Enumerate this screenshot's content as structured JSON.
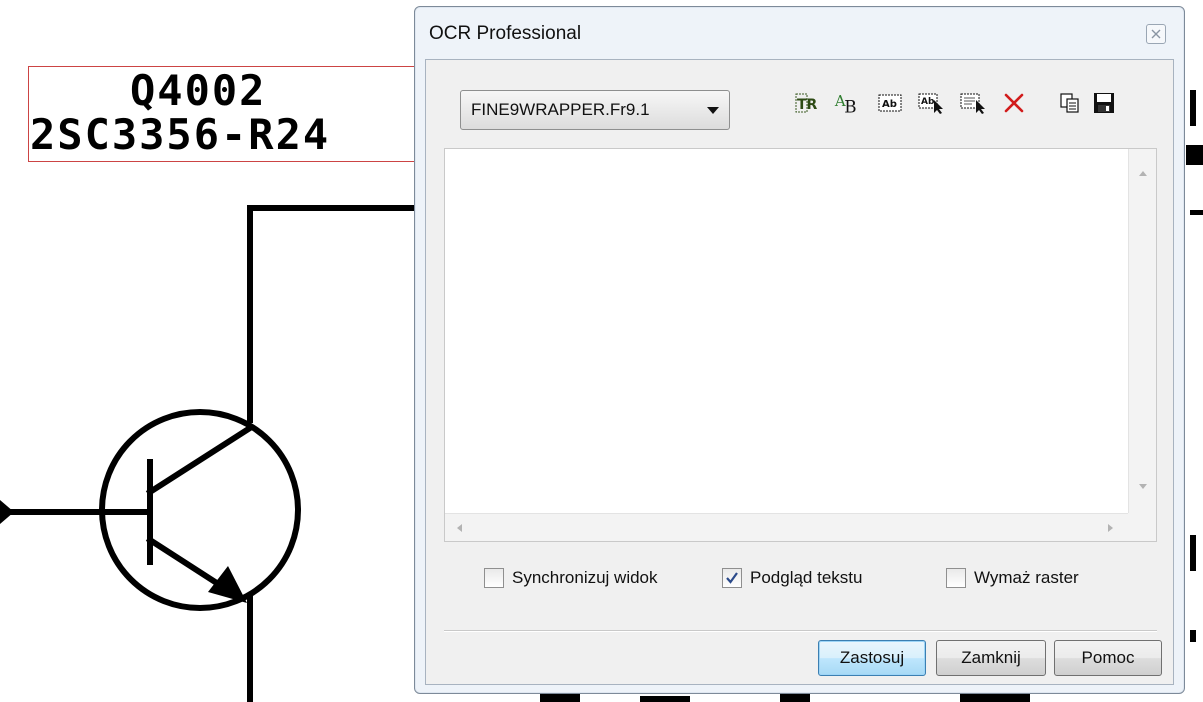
{
  "schematic": {
    "ref_label": "Q4002",
    "part_label": "2SC3356-R24"
  },
  "dialog": {
    "title": "OCR Professional",
    "close_icon": "close-icon",
    "engine_select": {
      "value": "FINE9WRAPPER.Fr9.1"
    },
    "toolbar": [
      {
        "name": "tr-icon"
      },
      {
        "name": "font-ab-icon"
      },
      {
        "name": "text-frame-icon"
      },
      {
        "name": "select-text-region-icon"
      },
      {
        "name": "select-area-icon"
      },
      {
        "name": "delete-x-icon"
      },
      {
        "name": "copy-icon"
      },
      {
        "name": "save-icon"
      }
    ],
    "options": {
      "sync_view": {
        "label": "Synchronizuj widok",
        "checked": false
      },
      "text_preview": {
        "label": "Podgląd tekstu",
        "checked": true
      },
      "erase_raster": {
        "label": "Wymaż raster",
        "checked": false
      }
    },
    "buttons": {
      "apply": "Zastosuj",
      "close": "Zamknij",
      "help": "Pomoc"
    },
    "colors": {
      "delete_red": "#d11b1b",
      "accent_blue": "#3c7fb1"
    }
  }
}
